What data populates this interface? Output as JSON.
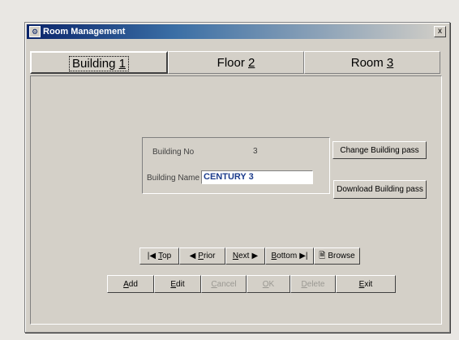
{
  "window": {
    "title": "Room Management",
    "close_label": "x"
  },
  "tabs": [
    {
      "label_pre": "Building ",
      "label_key": "1",
      "active": true
    },
    {
      "label_pre": "Floor ",
      "label_key": "2",
      "active": false
    },
    {
      "label_pre": "Room ",
      "label_key": "3",
      "active": false
    }
  ],
  "building": {
    "no_label": "Building No",
    "no_value": "3",
    "name_label": "Building Name",
    "name_value": "CENTURY 3"
  },
  "actions": {
    "change_pass": "Change Building pass",
    "download_pass": "Download Building pass"
  },
  "navigation": {
    "top": {
      "key": "T",
      "rest": "op"
    },
    "prior": {
      "key": "P",
      "rest": "rior"
    },
    "next": {
      "key": "N",
      "rest": "ext"
    },
    "bottom": {
      "key": "B",
      "rest": "ottom"
    },
    "browse": "Browse"
  },
  "commands": {
    "add": {
      "key": "A",
      "rest": "dd",
      "enabled": true
    },
    "edit": {
      "key": "E",
      "rest": "dit",
      "enabled": true
    },
    "cancel": {
      "key": "C",
      "rest": "ancel",
      "enabled": false
    },
    "ok": {
      "key": "O",
      "rest": "K",
      "enabled": false
    },
    "delete": {
      "key": "D",
      "rest": "elete",
      "enabled": false
    },
    "exit": {
      "key": "E",
      "rest": "xit",
      "enabled": true
    }
  }
}
